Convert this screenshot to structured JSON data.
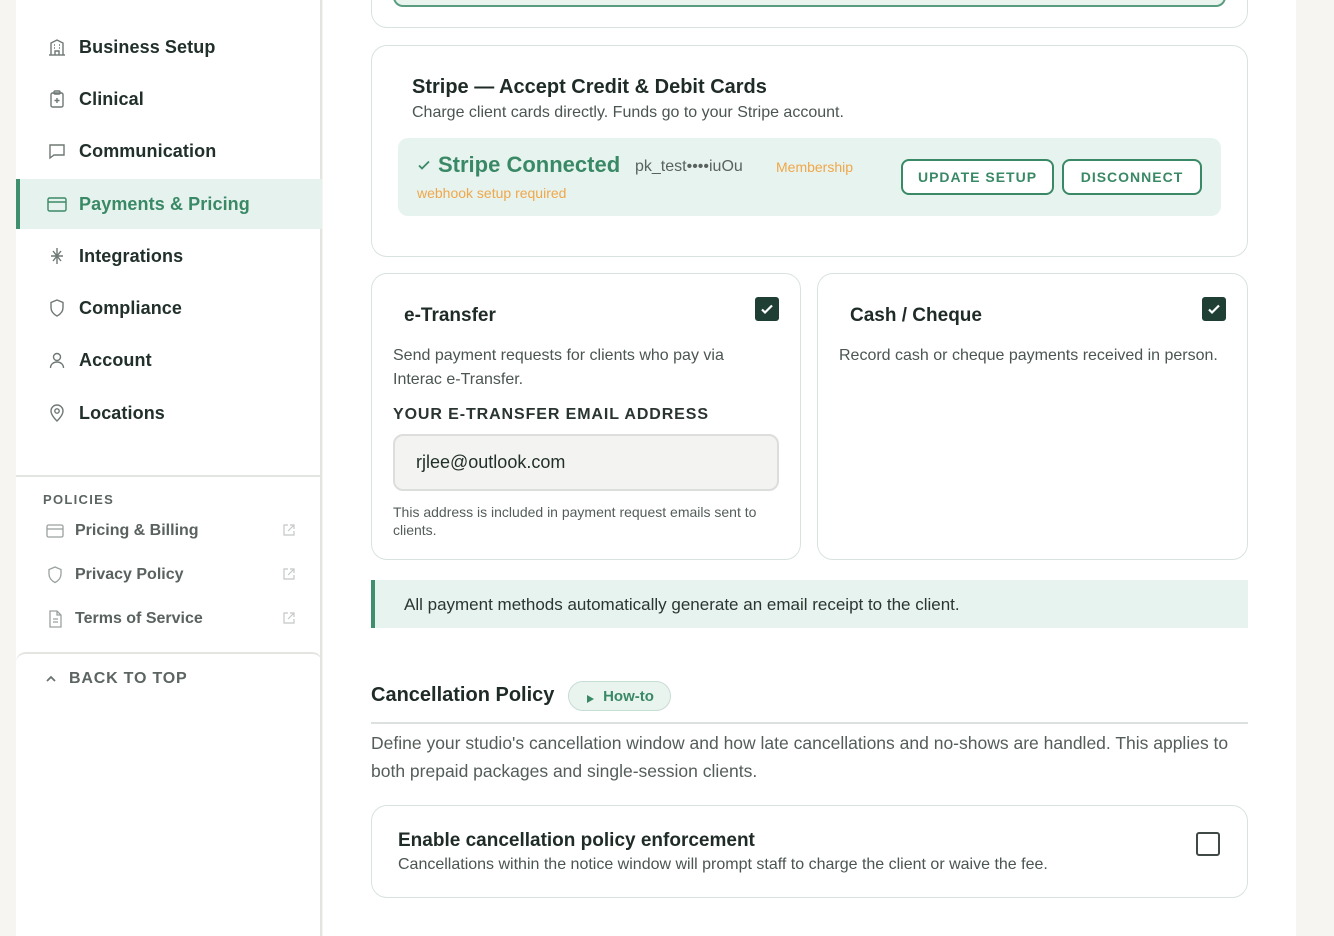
{
  "sidebar": {
    "nav": [
      {
        "label": "Business Setup",
        "icon": "building-icon"
      },
      {
        "label": "Clinical",
        "icon": "clipboard-icon"
      },
      {
        "label": "Communication",
        "icon": "chat-icon"
      },
      {
        "label": "Payments & Pricing",
        "icon": "credit-card-icon",
        "active": true
      },
      {
        "label": "Integrations",
        "icon": "integrations-icon"
      },
      {
        "label": "Compliance",
        "icon": "shield-icon"
      },
      {
        "label": "Account",
        "icon": "user-icon"
      },
      {
        "label": "Locations",
        "icon": "map-pin-icon"
      }
    ],
    "policies_heading": "POLICIES",
    "policies": [
      {
        "label": "Pricing & Billing",
        "icon": "credit-card-icon"
      },
      {
        "label": "Privacy Policy",
        "icon": "shield-icon"
      },
      {
        "label": "Terms of Service",
        "icon": "document-icon"
      }
    ],
    "back_to_top": "BACK TO TOP"
  },
  "stripe": {
    "title": "Stripe — Accept Credit & Debit Cards",
    "subtitle": "Charge client cards directly. Funds go to your Stripe account.",
    "status": "Stripe Connected",
    "key": "pk_test••••iuOu",
    "warning_line1": "Membership",
    "warning_line2": "webhook setup required",
    "update_label": "UPDATE SETUP",
    "disconnect_label": "DISCONNECT"
  },
  "etransfer": {
    "title": "e-Transfer",
    "description": "Send payment requests for clients who pay via Interac e-Transfer.",
    "checked": true,
    "field_label": "YOUR E-TRANSFER EMAIL ADDRESS",
    "email_value": "rjlee@outlook.com",
    "help": "This address is included in payment request emails sent to clients."
  },
  "cash": {
    "title": "Cash / Cheque",
    "description": "Record cash or cheque payments received in person.",
    "checked": true
  },
  "note": "All payment methods automatically generate an email receipt to the client.",
  "cancellation": {
    "title": "Cancellation Policy",
    "howto_label": "How-to",
    "description": "Define your studio's cancellation window and how late cancellations and no-shows are handled. This applies to both prepaid packages and single-session clients.",
    "enforce_title": "Enable cancellation policy enforcement",
    "enforce_desc": "Cancellations within the notice window will prompt staff to charge the client or waive the fee.",
    "enforce_checked": false
  },
  "colors": {
    "accent": "#3a8966",
    "accent_bg": "#e7f3ee",
    "warning": "#f0a74a",
    "checkbox_dark": "#1f3f35"
  }
}
